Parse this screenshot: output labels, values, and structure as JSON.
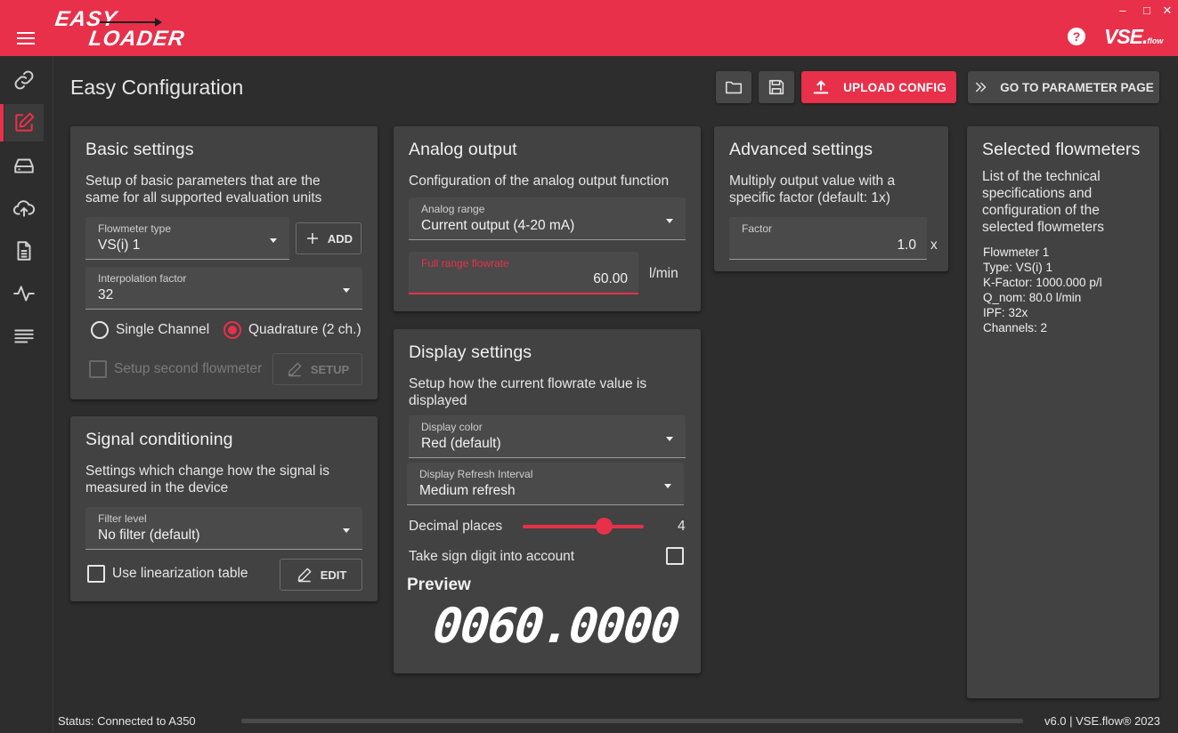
{
  "app": {
    "logo_line1": "EASY",
    "logo_line2": "LOADER",
    "brand": "VSE.",
    "brand_sub": "flow",
    "help": "?"
  },
  "window_controls": {
    "minimize": "–",
    "maximize": "□",
    "close": "✕"
  },
  "sidebar": {
    "items": [
      {
        "icon": "link-icon"
      },
      {
        "icon": "edit-icon",
        "active": true
      },
      {
        "icon": "device-icon"
      },
      {
        "icon": "cloud-upload-icon"
      },
      {
        "icon": "document-icon"
      },
      {
        "icon": "pulse-icon"
      },
      {
        "icon": "lines-icon"
      }
    ]
  },
  "header": {
    "title": "Easy Configuration",
    "upload_label": "UPLOAD CONFIG",
    "param_label": "GO TO PARAMETER PAGE"
  },
  "basic": {
    "title": "Basic settings",
    "desc": "Setup of basic parameters that are the same for all supported evaluation units",
    "flowmeter_type_label": "Flowmeter type",
    "flowmeter_type_value": "VS(i) 1",
    "add_label": "ADD",
    "interp_label": "Interpolation factor",
    "interp_value": "32",
    "radio_single": "Single Channel",
    "radio_quad": "Quadrature (2 ch.)",
    "second_label": "Setup second flowmeter",
    "setup_label": "SETUP"
  },
  "signal": {
    "title": "Signal conditioning",
    "desc": "Settings which change how the signal is measured in the device",
    "filter_label": "Filter level",
    "filter_value": "No filter (default)",
    "linear_label": "Use linearization table",
    "edit_label": "EDIT"
  },
  "analog": {
    "title": "Analog output",
    "desc": "Configuration of the analog output function",
    "range_label": "Analog range",
    "range_value": "Current output (4-20 mA)",
    "fullrange_label": "Full range flowrate",
    "fullrange_value": "60.00",
    "unit": "l/min"
  },
  "display": {
    "title": "Display settings",
    "desc": "Setup how the current flowrate value is displayed",
    "color_label": "Display color",
    "color_value": "Red (default)",
    "refresh_label": "Display Refresh Interval",
    "refresh_value": "Medium refresh",
    "decimal_label": "Decimal places",
    "decimal_value": "4",
    "sign_label": "Take sign digit into account",
    "preview_label": "Preview",
    "preview_value": "0060.0000"
  },
  "advanced": {
    "title": "Advanced settings",
    "desc": "Multiply output value with a specific factor (default: 1x)",
    "factor_label": "Factor",
    "factor_value": "1.0",
    "factor_unit": "x"
  },
  "selected": {
    "title": "Selected flowmeters",
    "desc": "List of the technical specifications and configuration of the selected flowmeters",
    "lines": [
      "Flowmeter 1",
      "Type: VS(i) 1",
      "K-Factor: 1000.000 p/l",
      "Q_nom: 80.0 l/min",
      "IPF: 32x",
      "Channels: 2"
    ]
  },
  "status": {
    "text": "Status: Connected to A350",
    "version": "v6.0 | VSE.flow® 2023"
  },
  "colors": {
    "accent": "#e8304a",
    "background": "#2d2d2d",
    "card": "#424242"
  }
}
